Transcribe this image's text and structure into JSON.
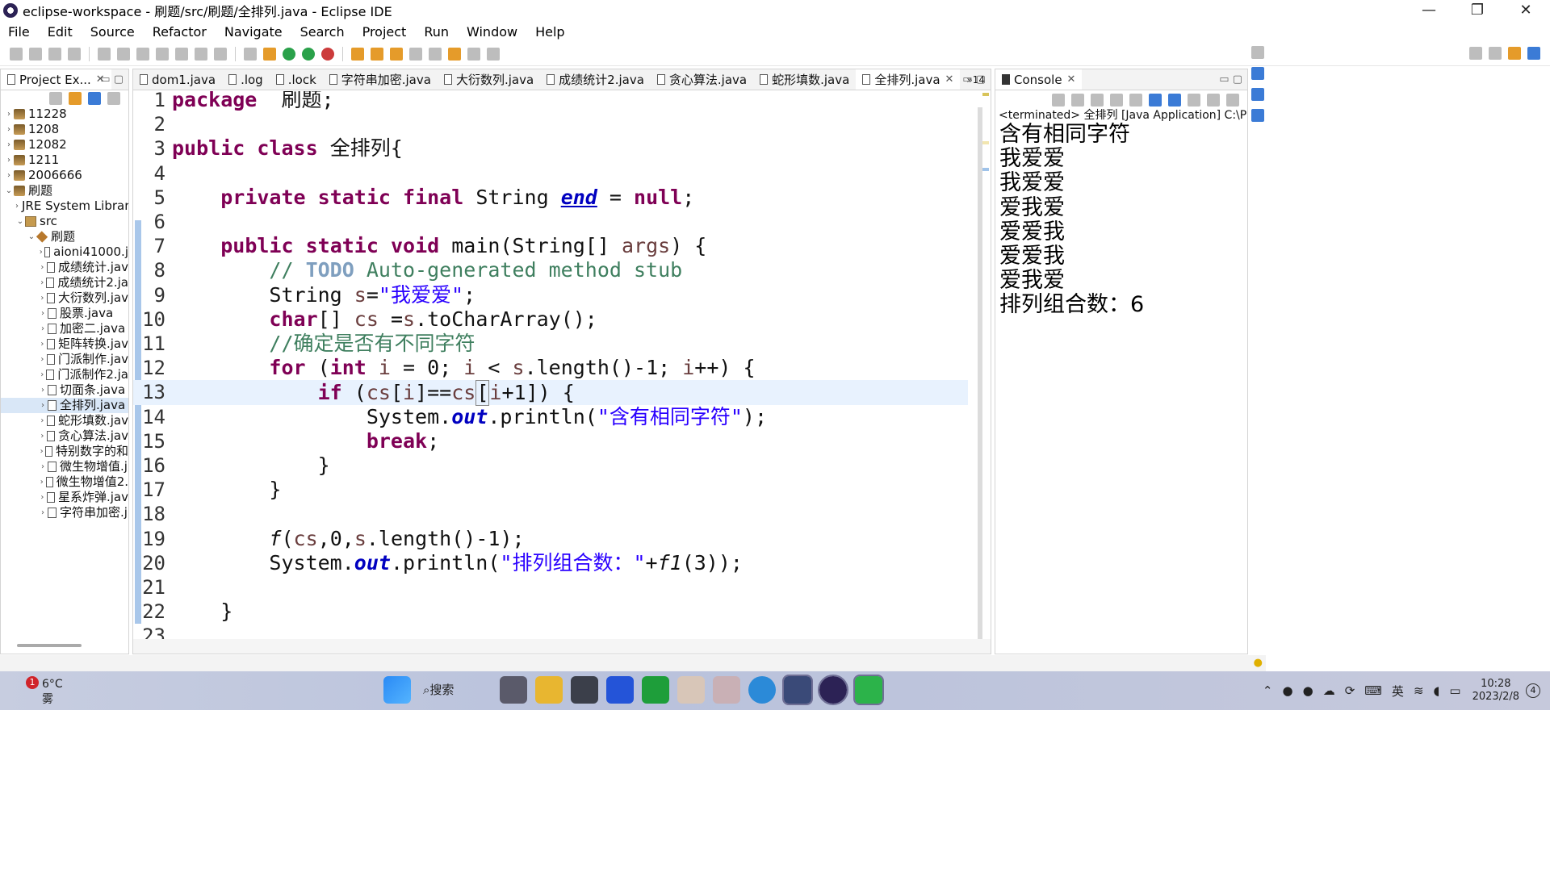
{
  "window": {
    "title": "eclipse-workspace - 刷题/src/刷题/全排列.java - Eclipse IDE",
    "controls": [
      "—",
      "❐",
      "✕"
    ]
  },
  "menu": [
    "File",
    "Edit",
    "Source",
    "Refactor",
    "Navigate",
    "Search",
    "Project",
    "Run",
    "Window",
    "Help"
  ],
  "explorer": {
    "tab_label": "Project Ex...",
    "tree": [
      {
        "label": "11228",
        "level": 0,
        "kind": "proj",
        "twisty": "›"
      },
      {
        "label": "1208",
        "level": 0,
        "kind": "proj",
        "twisty": "›"
      },
      {
        "label": "12082",
        "level": 0,
        "kind": "proj",
        "twisty": "›"
      },
      {
        "label": "1211",
        "level": 0,
        "kind": "proj",
        "twisty": "›"
      },
      {
        "label": "2006666",
        "level": 0,
        "kind": "proj",
        "twisty": "›"
      },
      {
        "label": "刷题",
        "level": 0,
        "kind": "proj",
        "twisty": "⌄"
      },
      {
        "label": "JRE System Librar",
        "level": 1,
        "kind": "lib",
        "twisty": "›"
      },
      {
        "label": "src",
        "level": 1,
        "kind": "src",
        "twisty": "⌄"
      },
      {
        "label": "刷题",
        "level": 2,
        "kind": "pkg",
        "twisty": "⌄"
      },
      {
        "label": "aioni41000.j",
        "level": 3,
        "kind": "java",
        "twisty": "›"
      },
      {
        "label": "成绩统计.jav",
        "level": 3,
        "kind": "java",
        "twisty": "›"
      },
      {
        "label": "成绩统计2.ja",
        "level": 3,
        "kind": "java",
        "twisty": "›"
      },
      {
        "label": "大衍数列.jav",
        "level": 3,
        "kind": "java",
        "twisty": "›"
      },
      {
        "label": "股票.java",
        "level": 3,
        "kind": "java",
        "twisty": "›"
      },
      {
        "label": "加密二.java",
        "level": 3,
        "kind": "java",
        "twisty": "›"
      },
      {
        "label": "矩阵转换.jav",
        "level": 3,
        "kind": "java",
        "twisty": "›"
      },
      {
        "label": "门派制作.jav",
        "level": 3,
        "kind": "java",
        "twisty": "›"
      },
      {
        "label": "门派制作2.ja",
        "level": 3,
        "kind": "java",
        "twisty": "›"
      },
      {
        "label": "切面条.java",
        "level": 3,
        "kind": "java",
        "twisty": "›"
      },
      {
        "label": "全排列.java",
        "level": 3,
        "kind": "java",
        "twisty": "›",
        "selected": true
      },
      {
        "label": "蛇形填数.jav",
        "level": 3,
        "kind": "java",
        "twisty": "›"
      },
      {
        "label": "贪心算法.jav",
        "level": 3,
        "kind": "java",
        "twisty": "›"
      },
      {
        "label": "特别数字的和",
        "level": 3,
        "kind": "java",
        "twisty": "›"
      },
      {
        "label": "微生物增值.j",
        "level": 3,
        "kind": "java",
        "twisty": "›"
      },
      {
        "label": "微生物增值2.",
        "level": 3,
        "kind": "java",
        "twisty": "›"
      },
      {
        "label": "星系炸弹.jav",
        "level": 3,
        "kind": "java",
        "twisty": "›"
      },
      {
        "label": "字符串加密.j",
        "level": 3,
        "kind": "java",
        "twisty": "›"
      }
    ]
  },
  "editor": {
    "tabs": [
      {
        "label": "dom1.java",
        "active": false
      },
      {
        "label": ".log",
        "active": false
      },
      {
        "label": ".lock",
        "active": false
      },
      {
        "label": "字符串加密.java",
        "active": false
      },
      {
        "label": "大衍数列.java",
        "active": false
      },
      {
        "label": "成绩统计2.java",
        "active": false
      },
      {
        "label": "贪心算法.java",
        "active": false
      },
      {
        "label": "蛇形填数.java",
        "active": false
      },
      {
        "label": "全排列.java",
        "active": true
      }
    ],
    "overflow_label": "»14",
    "lines": [
      {
        "n": "1",
        "tokens": [
          [
            "kw",
            "package"
          ],
          [
            "",
            "  刷题;"
          ]
        ]
      },
      {
        "n": "2",
        "tokens": []
      },
      {
        "n": "3",
        "tokens": [
          [
            "kw",
            "public"
          ],
          [
            "",
            " "
          ],
          [
            "kw",
            "class"
          ],
          [
            "",
            " 全排列{"
          ]
        ]
      },
      {
        "n": "4",
        "tokens": []
      },
      {
        "n": "5",
        "tokens": [
          [
            "",
            "    "
          ],
          [
            "kw",
            "private"
          ],
          [
            "",
            " "
          ],
          [
            "kw",
            "static"
          ],
          [
            "",
            " "
          ],
          [
            "kw",
            "final"
          ],
          [
            "",
            " String "
          ],
          [
            "sfield u",
            "end"
          ],
          [
            "",
            " = "
          ],
          [
            "kw",
            "null"
          ],
          [
            "",
            ";"
          ]
        ]
      },
      {
        "n": "6",
        "tokens": []
      },
      {
        "n": "7",
        "tokens": [
          [
            "",
            "    "
          ],
          [
            "kw",
            "public"
          ],
          [
            "",
            " "
          ],
          [
            "kw",
            "static"
          ],
          [
            "",
            " "
          ],
          [
            "kw",
            "void"
          ],
          [
            "",
            " main(String[] "
          ],
          [
            "local",
            "args"
          ],
          [
            "",
            ") {"
          ]
        ]
      },
      {
        "n": "8",
        "tokens": [
          [
            "",
            "        "
          ],
          [
            "cmt",
            "// "
          ],
          [
            "todo",
            "TODO"
          ],
          [
            "cmt",
            " Auto-generated method stub"
          ]
        ]
      },
      {
        "n": "9",
        "tokens": [
          [
            "",
            "        String "
          ],
          [
            "local",
            "s"
          ],
          [
            "",
            "="
          ],
          [
            "str",
            "\"我爱爱\""
          ],
          [
            "",
            ";"
          ]
        ]
      },
      {
        "n": "10",
        "tokens": [
          [
            "",
            "        "
          ],
          [
            "kw",
            "char"
          ],
          [
            "",
            "[] "
          ],
          [
            "local",
            "cs"
          ],
          [
            "",
            " ="
          ],
          [
            "local",
            "s"
          ],
          [
            "",
            ".toCharArray();"
          ]
        ]
      },
      {
        "n": "11",
        "tokens": [
          [
            "",
            "        "
          ],
          [
            "cmt",
            "//确定是否有不同字符"
          ]
        ]
      },
      {
        "n": "12",
        "tokens": [
          [
            "",
            "        "
          ],
          [
            "kw",
            "for"
          ],
          [
            "",
            " ("
          ],
          [
            "kw",
            "int"
          ],
          [
            "",
            " "
          ],
          [
            "local",
            "i"
          ],
          [
            "",
            " = 0; "
          ],
          [
            "local",
            "i"
          ],
          [
            "",
            " < "
          ],
          [
            "local",
            "s"
          ],
          [
            "",
            ".length()-1; "
          ],
          [
            "local",
            "i"
          ],
          [
            "",
            "++) {"
          ]
        ]
      },
      {
        "n": "13",
        "tokens": [
          [
            "",
            "            "
          ],
          [
            "kw",
            "if"
          ],
          [
            "",
            " ("
          ],
          [
            "local",
            "cs"
          ],
          [
            "",
            "["
          ],
          [
            "local",
            "i"
          ],
          [
            "",
            "]=="
          ],
          [
            "local",
            "cs"
          ],
          [
            "caret",
            "["
          ],
          [
            "local",
            "i"
          ],
          [
            "",
            "+1]) {"
          ]
        ],
        "current": true
      },
      {
        "n": "14",
        "tokens": [
          [
            "",
            "                System."
          ],
          [
            "sfield",
            "out"
          ],
          [
            "",
            ".println("
          ],
          [
            "str",
            "\"含有相同字符\""
          ],
          [
            "",
            ");"
          ]
        ]
      },
      {
        "n": "15",
        "tokens": [
          [
            "",
            "                "
          ],
          [
            "kw",
            "break"
          ],
          [
            "",
            ";"
          ]
        ]
      },
      {
        "n": "16",
        "tokens": [
          [
            "",
            "            }"
          ]
        ]
      },
      {
        "n": "17",
        "tokens": [
          [
            "",
            "        }"
          ]
        ]
      },
      {
        "n": "18",
        "tokens": []
      },
      {
        "n": "19",
        "tokens": [
          [
            "",
            "        "
          ],
          [
            "smeth",
            "f"
          ],
          [
            "",
            "("
          ],
          [
            "local",
            "cs"
          ],
          [
            "",
            ",0,"
          ],
          [
            "local",
            "s"
          ],
          [
            "",
            ".length()-1);"
          ]
        ]
      },
      {
        "n": "20",
        "tokens": [
          [
            "",
            "        System."
          ],
          [
            "sfield",
            "out"
          ],
          [
            "",
            ".println("
          ],
          [
            "str",
            "\"排列组合数：\""
          ],
          [
            "",
            "+"
          ],
          [
            "smeth",
            "f1"
          ],
          [
            "",
            "(3));"
          ]
        ]
      },
      {
        "n": "21",
        "tokens": []
      },
      {
        "n": "22",
        "tokens": [
          [
            "",
            "    }"
          ]
        ]
      },
      {
        "n": "23",
        "tokens": []
      }
    ]
  },
  "console": {
    "tab_label": "Console",
    "terminated": "<terminated> 全排列 [Java Application] C:\\Program",
    "output": [
      "含有相同字符",
      "我爱爱",
      "我爱爱",
      "爱我爱",
      "爱爱我",
      "爱爱我",
      "爱我爱",
      "排列组合数：6"
    ]
  },
  "taskbar": {
    "weather_badge": "1",
    "weather_temp": "6°C",
    "weather_cond": "雾",
    "search_label": "搜索",
    "ime": "英",
    "time": "10:28",
    "date": "2023/2/8",
    "notif_count": "4"
  }
}
